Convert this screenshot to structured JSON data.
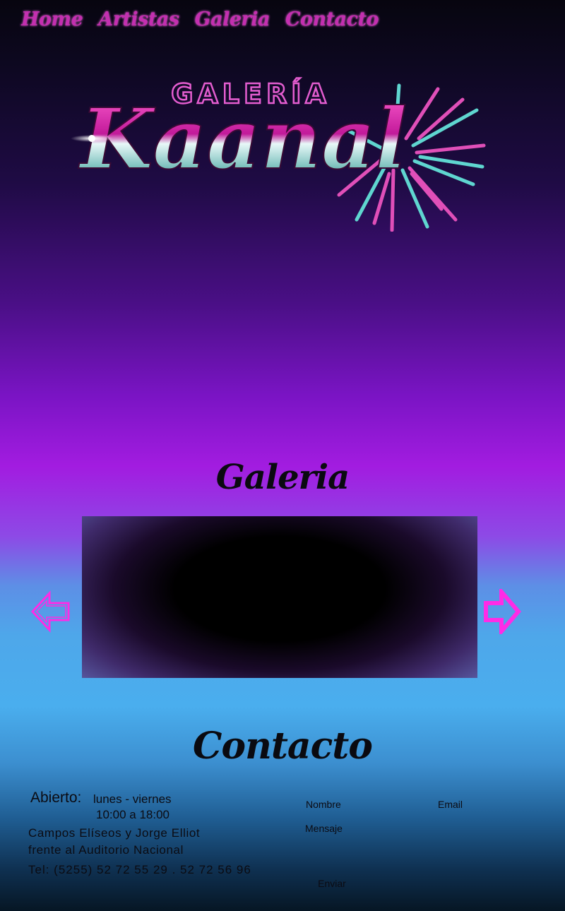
{
  "nav": {
    "items": [
      {
        "label": "Home"
      },
      {
        "label": "Artistas"
      },
      {
        "label": "Galeria"
      },
      {
        "label": "Contacto"
      }
    ]
  },
  "logo": {
    "top_text": "GALERÍA",
    "main_text": "Kaanal"
  },
  "gallery": {
    "title": "Galeria",
    "prev_icon": "arrow-left-outline-icon",
    "next_icon": "arrow-right-outline-icon"
  },
  "contact": {
    "title": "Contacto",
    "hours_label": "Abierto:",
    "hours_days": "lunes - viernes",
    "hours_time": "10:00 a 18:00",
    "address_line1": "Campos Elíseos y Jorge Elliot",
    "address_line2": "frente al Auditorio Nacional",
    "phone": "Tel: (5255) 52 72 55 29 . 52 72 56 96",
    "form": {
      "name_label": "Nombre",
      "email_label": "Email",
      "message_label": "Mensaje",
      "send_label": "Enviar"
    }
  },
  "colors": {
    "nav_text": "#c42fb0",
    "arrow": "#ff2be6"
  }
}
